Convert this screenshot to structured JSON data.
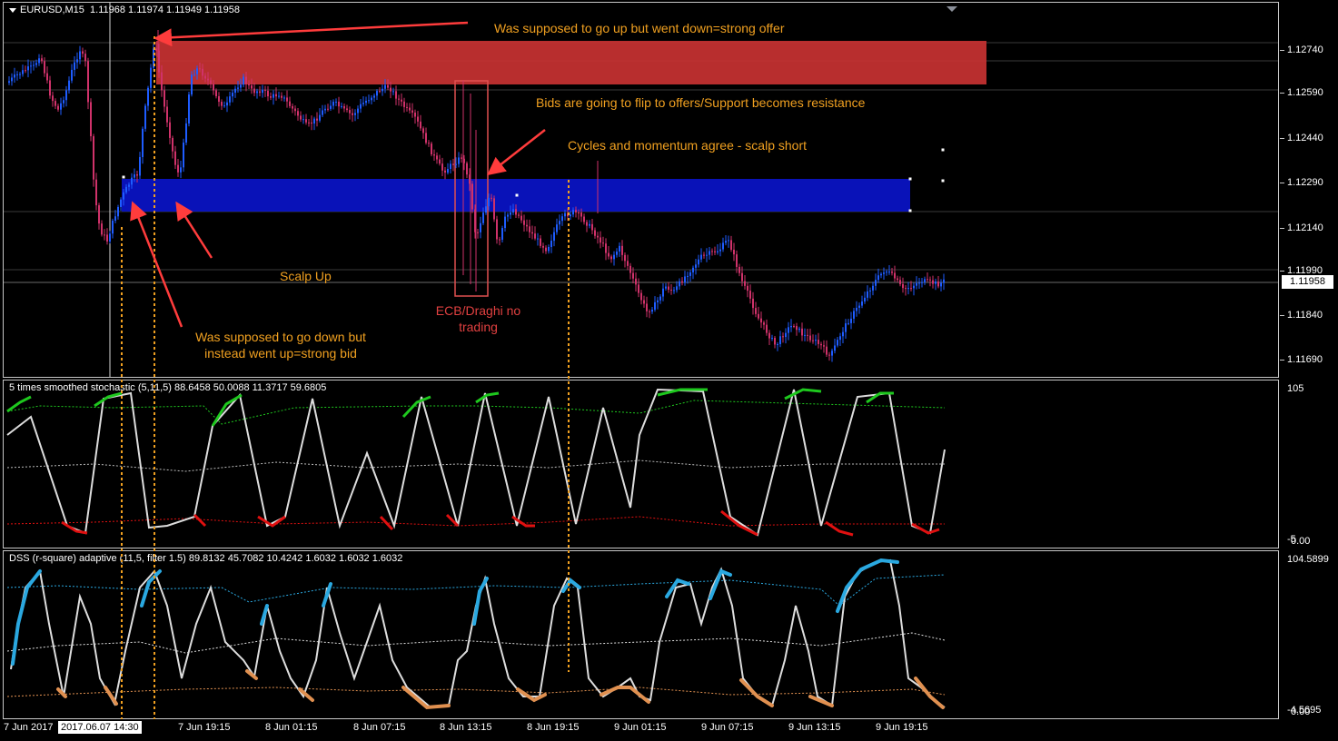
{
  "window": {
    "symbol": "EURUSD,M15",
    "ohlc": "1.11968 1.11974 1.11949 1.11958",
    "current_price": "1.11958"
  },
  "colors": {
    "bull_candle": "#1e5cff",
    "bear_candle": "#d0326a",
    "resistance_zone": "#c83232",
    "support_zone": "#0a14c8",
    "annotation_text": "#f0a020",
    "annotation_arrow": "#ff3c3c",
    "stoch_up": "#1ec81e",
    "stoch_down": "#e01010",
    "dss_up": "#2aa8e0",
    "dss_down": "#e09050"
  },
  "price_axis": [
    "1.12740",
    "1.12590",
    "1.12440",
    "1.12290",
    "1.12140",
    "1.11990",
    "1.11840",
    "1.11690"
  ],
  "annotations": {
    "top_note": "Was supposed to go up but went down=strong offer",
    "flip_note": "Bids are going to flip to offers/Support becomes resistance",
    "cycles_note": "Cycles and momentum agree - scalp short",
    "scalp_up": "Scalp Up",
    "ecb_note_1": "ECB/Draghi no",
    "ecb_note_2": "trading",
    "bid_note_1": "Was supposed to go down but",
    "bid_note_2": "instead went up=strong bid"
  },
  "stochastic": {
    "title": "5 times smoothed stochastic (5,11,5) 88.6458 50.0088 11.3717 59.6805",
    "axis_top": "105",
    "axis_bottom": "-5",
    "axis_bottom_overlap": "0.00"
  },
  "dss": {
    "title": "DSS (r-square) adaptive (11,5, filter 1.5) 89.8132 45.7082 10.4242 1.6032 1.6032 1.6032",
    "axis_top": "104.5899",
    "axis_bottom": "-4.5695",
    "axis_bottom_overlap": "0.00"
  },
  "time_axis": {
    "labels": [
      "7 Jun 2017",
      "7 Jun 19:15",
      "8 Jun 01:15",
      "8 Jun 07:15",
      "8 Jun 13:15",
      "8 Jun 19:15",
      "9 Jun 01:15",
      "9 Jun 07:15",
      "9 Jun 13:15",
      "9 Jun 19:15"
    ],
    "cursor_label": "2017.06.07 14:30"
  }
}
